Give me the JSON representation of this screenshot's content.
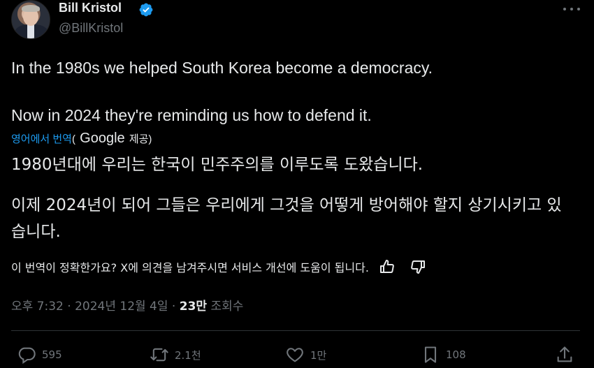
{
  "author": {
    "name": "Bill Kristol",
    "handle": "@BillKristol",
    "verified": true
  },
  "tweet": {
    "line1": "In the 1980s we helped South Korea become a democracy.",
    "line2": "Now in 2024 they're reminding us how to defend it."
  },
  "translation": {
    "label_link": "영어에서 번역",
    "label_open": "(",
    "provider": "Google",
    "label_close": "제공)",
    "line1": "1980년대에 우리는 한국이 민주주의를 이루도록 도왔습니다.",
    "line2a": "이제 2024년이 되어 그들은 우리에게 그것을 어떻게 방어해야 할지 상기시키고 있",
    "line2b": "습니다."
  },
  "feedback": {
    "prompt": "이 번역이 정확한가요? X에 의견을 남겨주시면 서비스 개선에 도움이 됩니다."
  },
  "meta": {
    "time": "오후 7:32",
    "separator1": " · ",
    "date": "2024년 12월 4일",
    "separator2": " · ",
    "views_count": "23만",
    "views_label": " 조회수"
  },
  "actions": {
    "replies": "595",
    "reposts": "2.1천",
    "likes": "1만",
    "bookmarks": "108"
  },
  "colors": {
    "background": "#000000",
    "text": "#e7e9ea",
    "muted": "#71767b",
    "accent": "#1d9bf0",
    "divider": "#2f3336"
  },
  "icons": [
    "verified-badge-icon",
    "more-icon",
    "thumbs-up-icon",
    "thumbs-down-icon",
    "reply-icon",
    "repost-icon",
    "like-icon",
    "bookmark-icon",
    "share-icon"
  ]
}
